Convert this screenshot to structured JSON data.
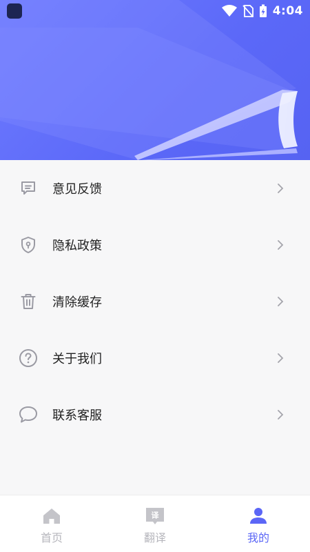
{
  "status_bar": {
    "time": "4:04"
  },
  "menu": {
    "items": [
      {
        "label": "意见反馈",
        "icon": "feedback-icon"
      },
      {
        "label": "隐私政策",
        "icon": "shield-icon"
      },
      {
        "label": "清除缓存",
        "icon": "trash-icon"
      },
      {
        "label": "关于我们",
        "icon": "question-icon"
      },
      {
        "label": "联系客服",
        "icon": "chat-icon"
      }
    ]
  },
  "tabbar": {
    "tabs": [
      {
        "label": "首页",
        "icon": "home-icon",
        "active": false
      },
      {
        "label": "翻译",
        "icon": "translate-icon",
        "glyph": "译",
        "active": false
      },
      {
        "label": "我的",
        "icon": "profile-icon",
        "active": true
      }
    ]
  },
  "colors": {
    "accent": "#5b66f6",
    "header": "#6470fa",
    "icon_gray": "#9a9aa3",
    "background": "#f7f7f8"
  }
}
